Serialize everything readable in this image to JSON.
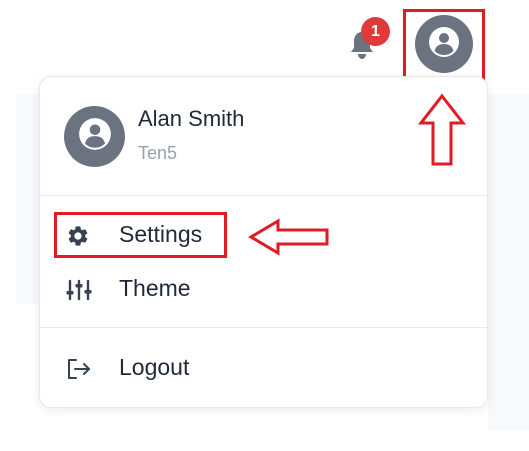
{
  "header": {
    "notification_count": "1",
    "bell_icon": "bell-icon",
    "avatar_icon": "user-circle-icon"
  },
  "dropdown": {
    "user": {
      "name": "Alan Smith",
      "org": "Ten5",
      "avatar_icon": "user-circle-icon"
    },
    "items": [
      {
        "label": "Settings",
        "icon": "gear-icon"
      },
      {
        "label": "Theme",
        "icon": "sliders-icon"
      },
      {
        "label": "Logout",
        "icon": "logout-icon"
      }
    ]
  },
  "colors": {
    "badge": "#e03b3b",
    "avatar": "#6b7280",
    "annotation": "#e01b24"
  }
}
